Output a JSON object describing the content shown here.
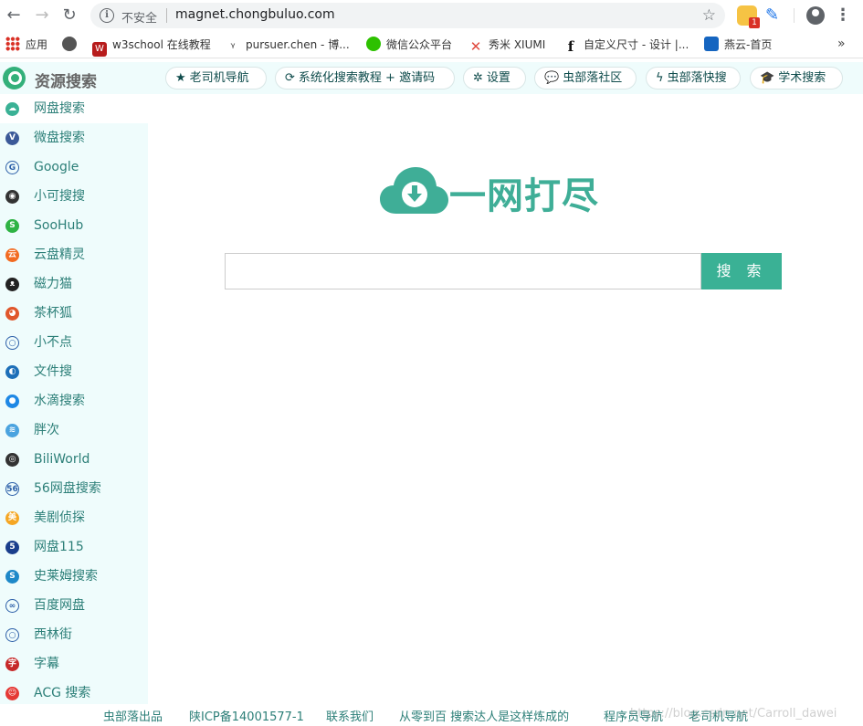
{
  "browser": {
    "security_label": "不安全",
    "url": "magnet.chongbuluo.com",
    "extension_badge": "1",
    "bookmarks": [
      {
        "label": "应用",
        "icon": "apps-icon"
      },
      {
        "label": "",
        "icon": "globe-icon"
      },
      {
        "label": "w3school 在线教程",
        "icon": "w3school-icon"
      },
      {
        "label": "pursuer.chen - 博...",
        "icon": "pursuer-icon"
      },
      {
        "label": "微信公众平台",
        "icon": "wechat-icon"
      },
      {
        "label": "秀米 XIUMI",
        "icon": "xiumi-icon"
      },
      {
        "label": "自定义尺寸 - 设计 |...",
        "icon": "font-f-icon"
      },
      {
        "label": "燕云-首页",
        "icon": "yanyun-icon"
      }
    ]
  },
  "header": {
    "logo_text": "资源搜索",
    "buttons": [
      {
        "label": "老司机导航",
        "icon": "★"
      },
      {
        "label": "系统化搜索教程 + 邀请码",
        "icon": "⟳"
      },
      {
        "label": "设置",
        "icon": "✲"
      },
      {
        "label": "虫部落社区",
        "icon": "💬"
      },
      {
        "label": "虫部落快搜",
        "icon": "ϟ"
      },
      {
        "label": "学术搜索",
        "icon": "🎓"
      }
    ]
  },
  "sidebar": {
    "items": [
      {
        "label": "网盘搜索",
        "color": "#3ab195",
        "glyph": "☁"
      },
      {
        "label": "微盘搜索",
        "color": "#3b5998",
        "glyph": "V"
      },
      {
        "label": "Google",
        "color": "#ffffff",
        "glyph": "G"
      },
      {
        "label": "小可搜搜",
        "color": "#333333",
        "glyph": "◉"
      },
      {
        "label": "SooHub",
        "color": "#2fb344",
        "glyph": "S"
      },
      {
        "label": "云盘精灵",
        "color": "#f26b21",
        "glyph": "云"
      },
      {
        "label": "磁力猫",
        "color": "#222222",
        "glyph": "ᴥ"
      },
      {
        "label": "茶杯狐",
        "color": "#e0562b",
        "glyph": "◕"
      },
      {
        "label": "小不点",
        "color": "#ffffff",
        "glyph": "○"
      },
      {
        "label": "文件搜",
        "color": "#1d6fb8",
        "glyph": "◐"
      },
      {
        "label": "水滴搜索",
        "color": "#1e88e5",
        "glyph": "●"
      },
      {
        "label": "胖次",
        "color": "#4aa3df",
        "glyph": "≋"
      },
      {
        "label": "BiliWorld",
        "color": "#333333",
        "glyph": "◎"
      },
      {
        "label": "56网盘搜索",
        "color": "#ffffff",
        "glyph": "56"
      },
      {
        "label": "美剧侦探",
        "color": "#f5a623",
        "glyph": "美"
      },
      {
        "label": "网盘115",
        "color": "#1a3e8c",
        "glyph": "5"
      },
      {
        "label": "史莱姆搜索",
        "color": "#1e88c8",
        "glyph": "S"
      },
      {
        "label": "百度网盘",
        "color": "#ffffff",
        "glyph": "∞"
      },
      {
        "label": "西林街",
        "color": "#ffffff",
        "glyph": "○"
      },
      {
        "label": "字幕",
        "color": "#c62828",
        "glyph": "字"
      },
      {
        "label": "ACG 搜索",
        "color": "#e53935",
        "glyph": "☺"
      }
    ]
  },
  "main": {
    "hero_text": "一网打尽",
    "search_value": "",
    "search_button": "搜 索"
  },
  "footer": {
    "links": [
      "虫部落出品",
      "陕ICP备14001577-1",
      "联系我们",
      "从零到百 搜索达人是这样炼成的",
      "程序员导航",
      "老司机导航"
    ],
    "watermark": "https://blog.csdn.net/Carroll_dawei"
  },
  "colors": {
    "accent": "#3ab195",
    "sidebar_bg": "#effcfc",
    "link": "#2c7f78"
  }
}
